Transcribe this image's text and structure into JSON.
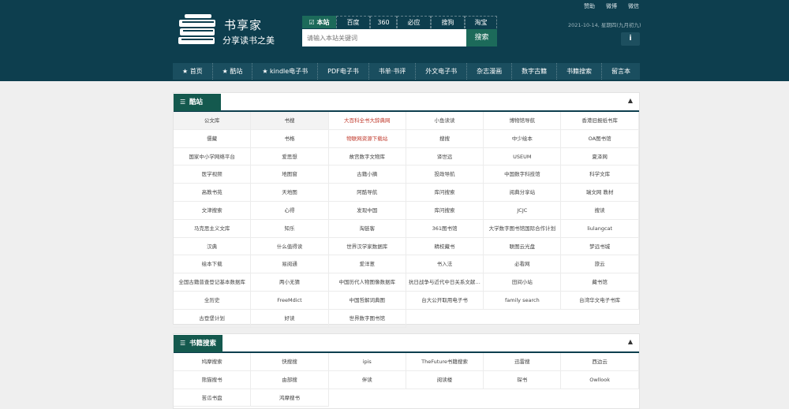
{
  "site": {
    "title": "书享家",
    "subtitle": "分享读书之美"
  },
  "search": {
    "tabs": [
      "本站",
      "百度",
      "360",
      "必应",
      "搜狗",
      "淘宝"
    ],
    "placeholder": "请输入本站关键词",
    "button": "搜索"
  },
  "toplinks": [
    "赞助",
    "微博",
    "微信"
  ],
  "date": "2021-10-14, 星期四(九月初九)",
  "info_icon": "i",
  "nav": [
    {
      "label": "首页",
      "star": true
    },
    {
      "label": "酷站",
      "star": true
    },
    {
      "label": "kindle电子书",
      "star": true
    },
    {
      "label": "PDF电子书",
      "star": false
    },
    {
      "label": "书单·书评",
      "star": false
    },
    {
      "label": "外文电子书",
      "star": false
    },
    {
      "label": "杂志漫画",
      "star": false
    },
    {
      "label": "数字古籍",
      "star": false
    },
    {
      "label": "书籍搜索",
      "star": false
    },
    {
      "label": "留言本",
      "star": false
    }
  ],
  "panel_kuzhan": {
    "title": "酷站",
    "title_icon": "list-icon",
    "collapse_icon": "chevron-up-icon",
    "items": [
      {
        "label": "公文库",
        "style": "gray"
      },
      {
        "label": "书搜",
        "style": "gray"
      },
      {
        "label": "大百科全书大辞典网",
        "style": "red"
      },
      {
        "label": "小鱼读读",
        "style": ""
      },
      {
        "label": "博物馆导航",
        "style": ""
      },
      {
        "label": "香港旧报纸书库",
        "style": ""
      },
      {
        "label": "儒藏",
        "style": ""
      },
      {
        "label": "书格",
        "style": ""
      },
      {
        "label": "物联网资源下载站",
        "style": "red"
      },
      {
        "label": "搜搜",
        "style": ""
      },
      {
        "label": "中少绘本",
        "style": ""
      },
      {
        "label": "OA图书馆",
        "style": ""
      },
      {
        "label": "国家中小学网络平台",
        "style": ""
      },
      {
        "label": "爱思想",
        "style": ""
      },
      {
        "label": "故宫数字文物库",
        "style": ""
      },
      {
        "label": "译世远",
        "style": ""
      },
      {
        "label": "USEUM",
        "style": ""
      },
      {
        "label": "夏泽网",
        "style": ""
      },
      {
        "label": "医学视频",
        "style": ""
      },
      {
        "label": "地图窗",
        "style": ""
      },
      {
        "label": "古籍小摘",
        "style": ""
      },
      {
        "label": "投政导航",
        "style": ""
      },
      {
        "label": "中国数字科技馆",
        "style": ""
      },
      {
        "label": "科学文库",
        "style": ""
      },
      {
        "label": "高教书苑",
        "style": ""
      },
      {
        "label": "天地图",
        "style": ""
      },
      {
        "label": "阿酷导航",
        "style": ""
      },
      {
        "label": "库问搜索",
        "style": ""
      },
      {
        "label": "阅典分享站",
        "style": ""
      },
      {
        "label": "瑞文网 教材",
        "style": ""
      },
      {
        "label": "文津搜索",
        "style": ""
      },
      {
        "label": "心得",
        "style": ""
      },
      {
        "label": "发现中国",
        "style": ""
      },
      {
        "label": "库问搜索",
        "style": ""
      },
      {
        "label": "JCJC",
        "style": ""
      },
      {
        "label": "搜读",
        "style": ""
      },
      {
        "label": "马克思主义文库",
        "style": ""
      },
      {
        "label": "知乐",
        "style": ""
      },
      {
        "label": "淘链客",
        "style": ""
      },
      {
        "label": "361图书馆",
        "style": ""
      },
      {
        "label": "大学数字图书馆国际合作计划",
        "style": ""
      },
      {
        "label": "liulangcat",
        "style": ""
      },
      {
        "label": "汉典",
        "style": ""
      },
      {
        "label": "什么值得读",
        "style": ""
      },
      {
        "label": "世界汉学家数据库",
        "style": ""
      },
      {
        "label": "精校藏书",
        "style": ""
      },
      {
        "label": "联图云光盘",
        "style": ""
      },
      {
        "label": "梦远书城",
        "style": ""
      },
      {
        "label": "绘本下载",
        "style": ""
      },
      {
        "label": "易阅通",
        "style": ""
      },
      {
        "label": "爱洋葱",
        "style": ""
      },
      {
        "label": "书入法",
        "style": ""
      },
      {
        "label": "必看网",
        "style": ""
      },
      {
        "label": "旅云",
        "style": ""
      },
      {
        "label": "全国古籍普查登记基本数据库",
        "style": ""
      },
      {
        "label": "两小无猜",
        "style": ""
      },
      {
        "label": "中国历代人物图像数据库",
        "style": ""
      },
      {
        "label": "抗日战争与近代中日关系文献数据平台",
        "style": ""
      },
      {
        "label": "田间小站",
        "style": ""
      },
      {
        "label": "藏书馆",
        "style": ""
      },
      {
        "label": "全历史",
        "style": ""
      },
      {
        "label": "FreeMdict",
        "style": ""
      },
      {
        "label": "中国哲解词典图",
        "style": ""
      },
      {
        "label": "台大公开取用电子书",
        "style": ""
      },
      {
        "label": "family search",
        "style": ""
      },
      {
        "label": "台湾华文电子书库",
        "style": ""
      },
      {
        "label": "古登堡计划",
        "style": ""
      },
      {
        "label": "好读",
        "style": ""
      },
      {
        "label": "世界数字图书馆",
        "style": ""
      }
    ]
  },
  "panel_search": {
    "title": "书籍搜索",
    "title_icon": "list-icon",
    "collapse_icon": "chevron-up-icon",
    "items": [
      {
        "label": "鸠摩搜索",
        "style": ""
      },
      {
        "label": "快搜搜",
        "style": ""
      },
      {
        "label": "ipis",
        "style": ""
      },
      {
        "label": "TheFuture书籍搜索",
        "style": ""
      },
      {
        "label": "迅雷搜",
        "style": ""
      },
      {
        "label": "西边云",
        "style": ""
      },
      {
        "label": "熊猫搜书",
        "style": ""
      },
      {
        "label": "由部搜",
        "style": ""
      },
      {
        "label": "伴读",
        "style": ""
      },
      {
        "label": "阅读楼",
        "style": ""
      },
      {
        "label": "琛书",
        "style": ""
      },
      {
        "label": "Owllook",
        "style": ""
      },
      {
        "label": "苦瓜书盘",
        "style": ""
      },
      {
        "label": "鸿摩搜书",
        "style": ""
      }
    ]
  }
}
